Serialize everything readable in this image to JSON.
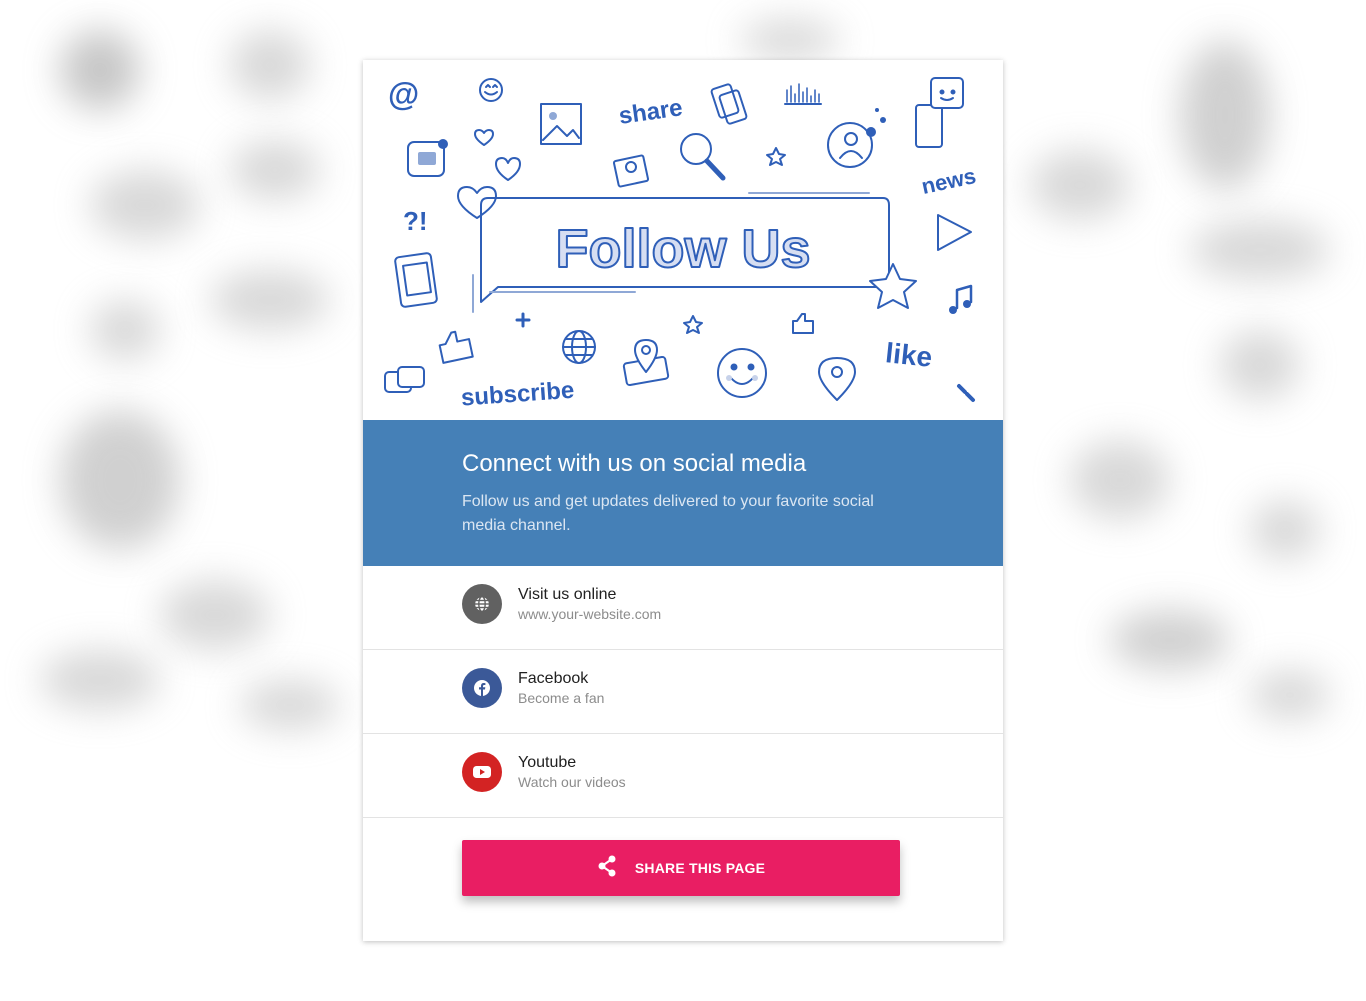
{
  "hero": {
    "title": "Follow Us",
    "words": {
      "share": "share",
      "news": "news",
      "like": "like",
      "subscribe": "subscribe",
      "at": "@",
      "interrobang": "?!"
    }
  },
  "banner": {
    "heading": "Connect with us on social media",
    "text": "Follow us and get updates delivered to your favorite social media channel."
  },
  "links": [
    {
      "title": "Visit us online",
      "subtitle": "www.your-website.com",
      "icon": "globe-icon",
      "color": "#616161"
    },
    {
      "title": "Facebook",
      "subtitle": "Become a fan",
      "icon": "facebook-icon",
      "color": "#3b5998"
    },
    {
      "title": "Youtube",
      "subtitle": "Watch our videos",
      "icon": "youtube-icon",
      "color": "#d32323"
    }
  ],
  "share_button": {
    "label": "SHARE THIS PAGE",
    "icon": "share-icon",
    "color": "#e91e63"
  },
  "colors": {
    "accent_blue": "#4580b7",
    "illustration_blue": "#2f5fb8"
  }
}
